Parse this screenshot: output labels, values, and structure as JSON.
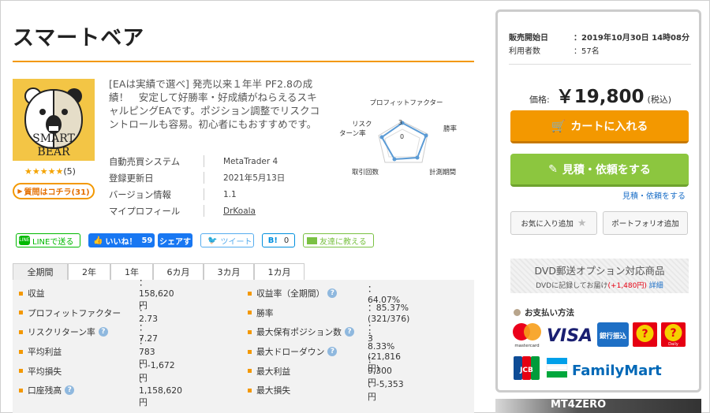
{
  "product": {
    "title": "スマートベア",
    "logo_text_1": "SMART",
    "logo_text_2": "BEAR",
    "rating_stars": "★★★★★",
    "rating_count": "(5)",
    "question_button": "質問はコチラ(31)",
    "description": "[EAは実績で選べ] 発売以来１年半 PF2.8の成績！　安定して好勝率・好成績がねらえるスキャルピングEAです。ポジション調整でリスクコントロールも容易。初心者にもおすすめです。"
  },
  "specs": [
    {
      "key": "自動売買システム",
      "value": "MetaTrader 4"
    },
    {
      "key": "登録更新日",
      "value": "2021年5月13日"
    },
    {
      "key": "バージョン情報",
      "value": "1.1"
    },
    {
      "key": "マイプロフィール",
      "value": "DrKoala"
    }
  ],
  "radar": {
    "labels": {
      "pf": "プロフィットファクター",
      "winrate": "勝率",
      "period": "計測期間",
      "trades": "取引回数",
      "risk_1": "リスク",
      "risk_2": "ターン率"
    },
    "tick_3": "3",
    "tick_0": "0"
  },
  "social": {
    "line": "LINEで送る",
    "fb_like": "いいね！",
    "fb_count": "59",
    "fb_share": "シェアす",
    "tweet": "ツイート",
    "hatena": "B!",
    "hatena_count": "0",
    "mail": "友達に教える"
  },
  "tabs": [
    "全期間",
    "2年",
    "1年",
    "6カ月",
    "3カ月",
    "1カ月"
  ],
  "stats_left": [
    {
      "label": "収益",
      "value": "：158,620円",
      "help": false
    },
    {
      "label": "プロフィットファクター",
      "value": "：2.73",
      "help": false
    },
    {
      "label": "リスクリターン率",
      "value": "：7.27",
      "help": true
    },
    {
      "label": "平均利益",
      "value": "：783円",
      "help": false
    },
    {
      "label": "平均損失",
      "value": "：-1,672円",
      "help": false
    },
    {
      "label": "口座残高",
      "value": "：1,158,620円",
      "help": true
    }
  ],
  "stats_right": [
    {
      "label": "収益率（全期間）",
      "value": "：64.07%",
      "help": true
    },
    {
      "label": "勝率",
      "value": "：85.37% (321/376)",
      "help": false
    },
    {
      "label": "最大保有ポジション数",
      "value": "：3",
      "help": true
    },
    {
      "label": "最大ドローダウン",
      "value": "：8.33% (21,816円)",
      "help": true
    },
    {
      "label": "最大利益",
      "value": "：9,300円",
      "help": false
    },
    {
      "label": "最大損失",
      "value": "：-5,353円",
      "help": false
    }
  ],
  "sidebar": {
    "sale_start_label": "販売開始日",
    "sale_start_value": "：2019年10月30日 14時08分",
    "users_label": "利用者数",
    "users_value": "：57名",
    "price_label": "価格:",
    "price_value": "￥19,800",
    "tax": "(税込)",
    "cart_button": "カートに入れる",
    "quote_button": "見積・依頼をする",
    "quote_link": "見積・依頼をする",
    "fav_button": "お気に入り追加",
    "portfolio_button": "ポートフォリオ追加",
    "dvd_title": "DVD郵送オプション対応商品",
    "dvd_note": "DVDに記録してお届け",
    "dvd_price": "(+1,480円)",
    "dvd_link": "詳細",
    "payment_title": "お支払い方法",
    "mastercard": "mastercard",
    "visa": "VISA",
    "bank": "銀行振込",
    "familymart": "FamilyMart",
    "jcb": "JCB",
    "daily": "Daily"
  },
  "banner": {
    "text": "MT4ZERO"
  },
  "colors": {
    "accent_orange": "#f39800",
    "green": "#8cc63f",
    "link_blue": "#1a6ec7"
  }
}
